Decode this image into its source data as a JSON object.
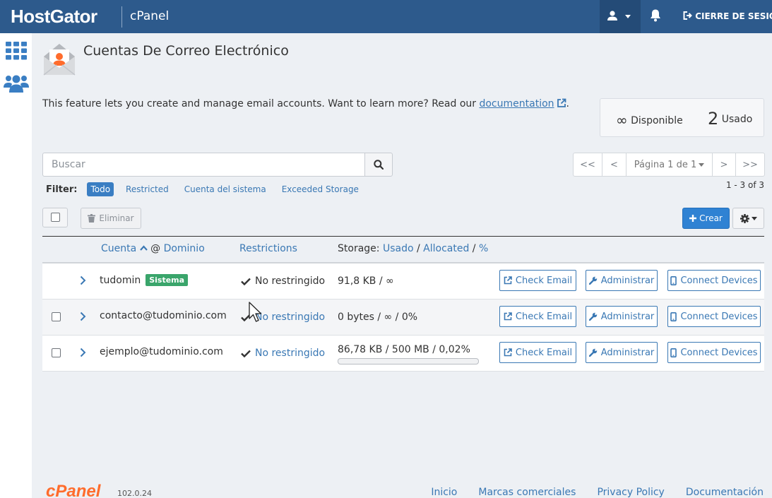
{
  "header": {
    "brand": "HostGator",
    "product": "cPanel",
    "logout_label": "CIERRE DE SESIÓN"
  },
  "page": {
    "title": "Cuentas De Correo Electrónico",
    "description": "This feature lets you create and manage email accounts. Want to learn more? Read our",
    "doc_link": "documentation",
    "doc_suffix": "."
  },
  "stats": {
    "available_symbol": "∞",
    "available_label": "Disponible",
    "used_count": "2",
    "used_label": "Usado"
  },
  "search": {
    "placeholder": "Buscar"
  },
  "pagination": {
    "first": "<<",
    "prev": "<",
    "page_label": "Página 1 de 1",
    "next": ">",
    "last": ">>",
    "count": "1 - 3 of 3"
  },
  "filter": {
    "label": "Filter:",
    "options": [
      "Todo",
      "Restricted",
      "Cuenta del sistema",
      "Exceeded Storage"
    ]
  },
  "toolbar": {
    "delete_label": "Eliminar",
    "create_label": "Crear"
  },
  "table": {
    "headers": {
      "account": "Cuenta",
      "at": "@",
      "domain": "Dominio",
      "restrictions": "Restrictions",
      "storage": "Storage:",
      "used": "Usado",
      "sep1": "/",
      "allocated": "Allocated",
      "sep2": "/",
      "percent": "%"
    },
    "rows": [
      {
        "account": "tudomin",
        "badge": "Sistema",
        "restriction": "No restringido",
        "storage": "91,8 KB / ∞",
        "check_email": "Check Email",
        "manage": "Administrar",
        "connect": "Connect Devices"
      },
      {
        "account": "contacto@tudominio.com",
        "restriction": "No restringido",
        "storage": "0 bytes / ∞ / 0%",
        "check_email": "Check Email",
        "manage": "Administrar",
        "connect": "Connect Devices"
      },
      {
        "account": "ejemplo@tudominio.com",
        "restriction": "No restringido",
        "storage": "86,78 KB / 500 MB / 0,02%",
        "usage_fraction": 0.0002,
        "check_email": "Check Email",
        "manage": "Administrar",
        "connect": "Connect Devices"
      }
    ]
  },
  "footer": {
    "logo": "cPanel",
    "version": "102.0.24",
    "links": [
      "Inicio",
      "Marcas comerciales",
      "Privacy Policy",
      "Documentación"
    ]
  },
  "colors": {
    "header": "#2d5a8c",
    "accent": "#2f82d3",
    "link": "#3a78b4",
    "badge": "#3aa56b",
    "cpanel_orange": "#ff6c2c"
  }
}
